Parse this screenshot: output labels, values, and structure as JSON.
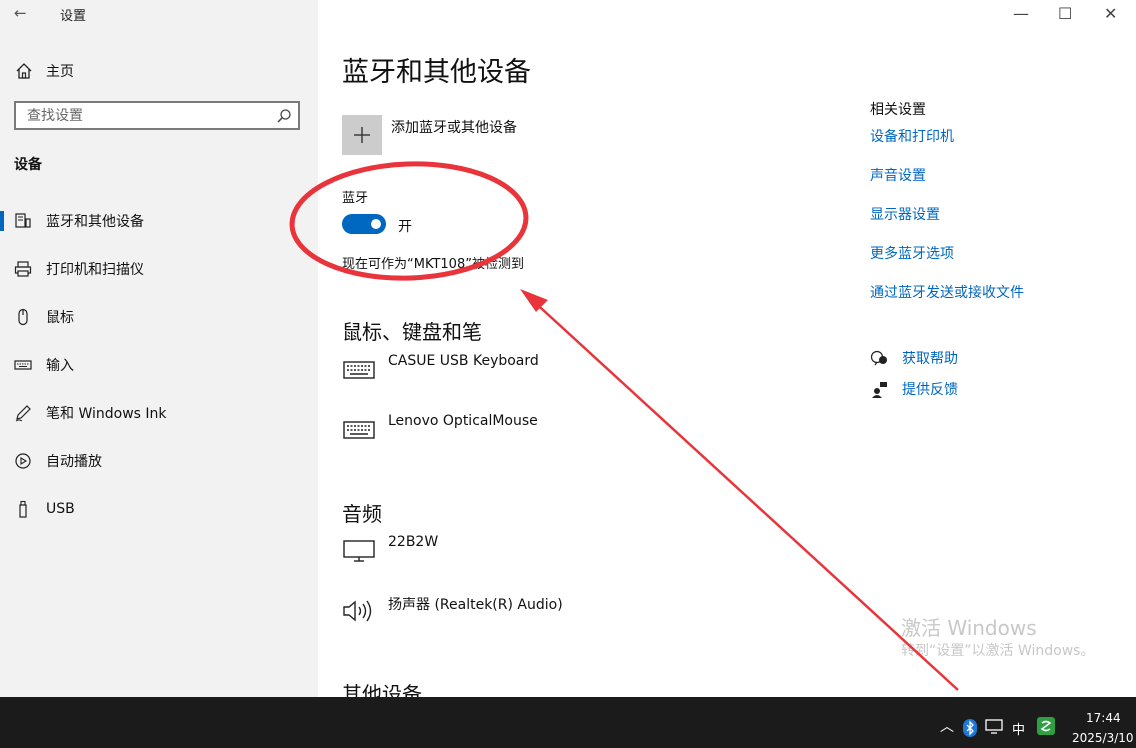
{
  "window": {
    "title": "设置"
  },
  "sidebar": {
    "home_label": "主页",
    "search_placeholder": "查找设置",
    "section_title": "设备",
    "items": [
      {
        "label": "蓝牙和其他设备",
        "icon": "bluetooth-devices-icon",
        "active": true
      },
      {
        "label": "打印机和扫描仪",
        "icon": "printer-icon"
      },
      {
        "label": "鼠标",
        "icon": "mouse-icon"
      },
      {
        "label": "输入",
        "icon": "keyboard-icon"
      },
      {
        "label": "笔和 Windows Ink",
        "icon": "pen-icon"
      },
      {
        "label": "自动播放",
        "icon": "autoplay-icon"
      },
      {
        "label": "USB",
        "icon": "usb-icon"
      }
    ]
  },
  "main": {
    "title": "蓝牙和其他设备",
    "add_device_label": "添加蓝牙或其他设备",
    "bluetooth": {
      "label": "蓝牙",
      "state": "开",
      "discoverable_text": "现在可作为“MKT108”被检测到"
    },
    "mouse_keyboard": {
      "heading": "鼠标、键盘和笔",
      "devices": [
        "CASUE USB Keyboard",
        "Lenovo OpticalMouse"
      ]
    },
    "audio": {
      "heading": "音频",
      "devices": [
        "22B2W",
        "扬声器 (Realtek(R) Audio)"
      ]
    },
    "other_heading": "其他设备"
  },
  "related": {
    "heading": "相关设置",
    "links": [
      "设备和打印机",
      "声音设置",
      "显示器设置",
      "更多蓝牙选项",
      "通过蓝牙发送或接收文件"
    ],
    "help_label": "获取帮助",
    "feedback_label": "提供反馈"
  },
  "watermark": {
    "line1": "激活 Windows",
    "line2": "转到“设置”以激活 Windows。"
  },
  "taskbar": {
    "ime": "中",
    "time": "17:44",
    "date": "2025/3/10"
  },
  "colors": {
    "accent": "#0067c0",
    "annotation": "#e8343a",
    "sidebar_bg": "#f2f2f2",
    "taskbar_bg": "#1b1b1b"
  }
}
